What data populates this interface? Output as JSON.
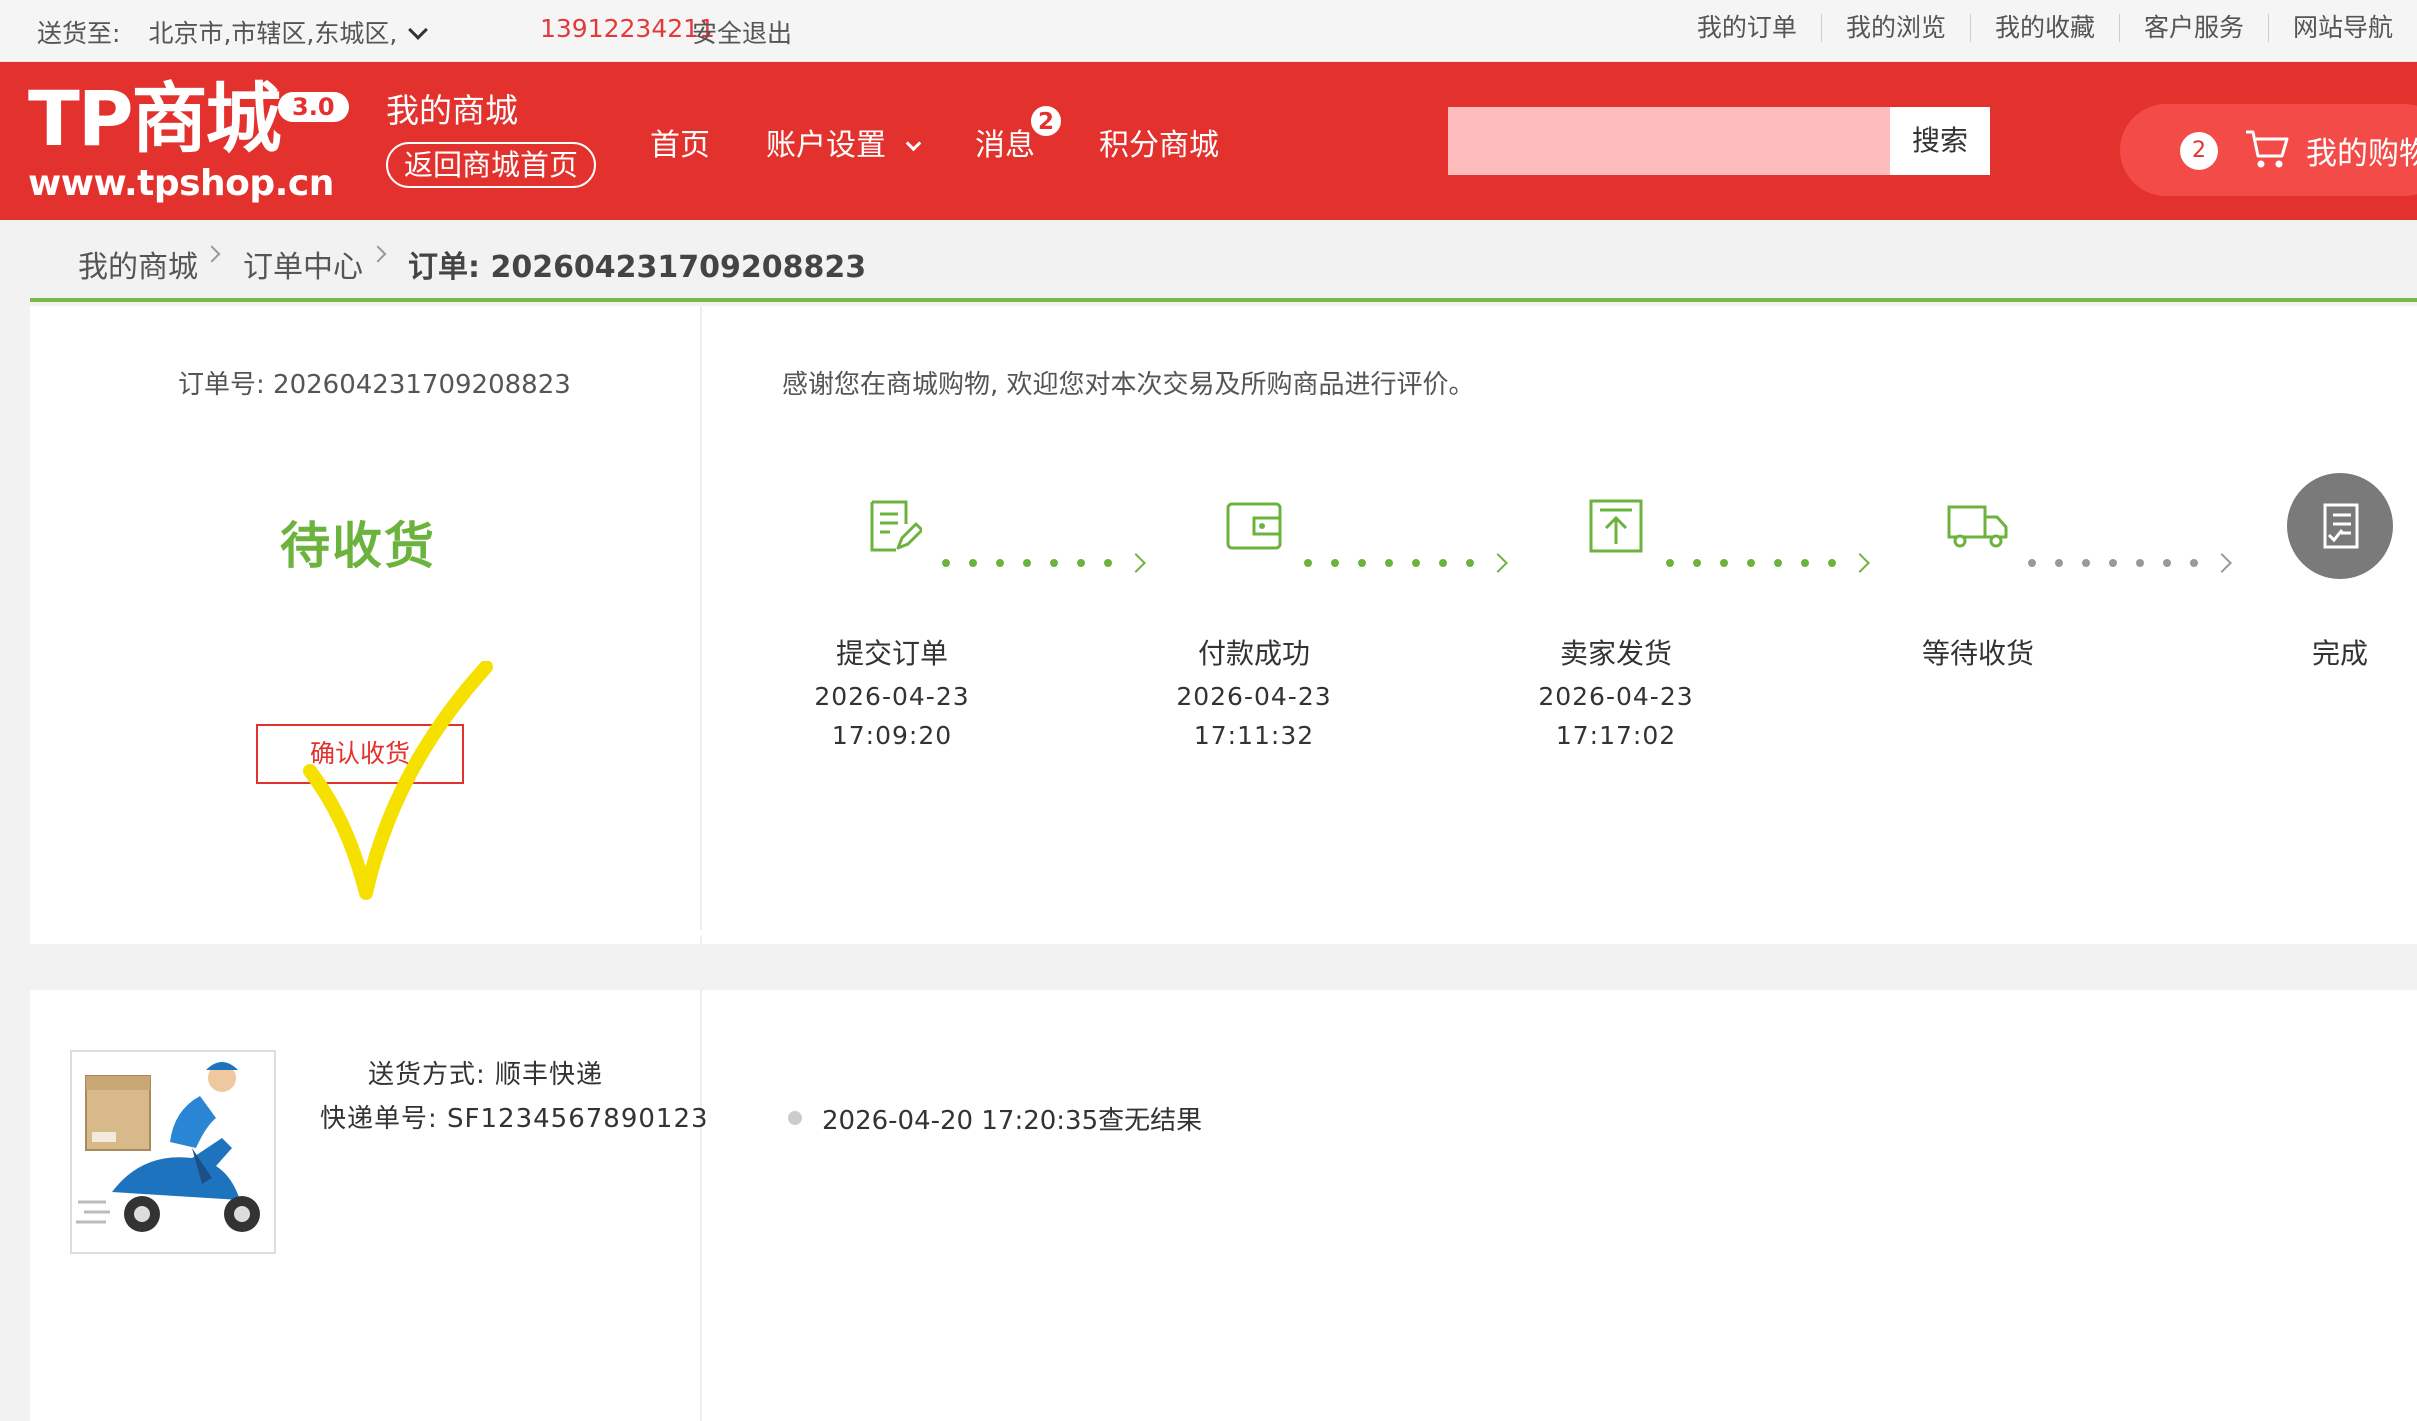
{
  "topbar": {
    "ship_label": "送货至:",
    "location": "北京市,市辖区,东城区,",
    "phone": "13912234211",
    "logout": "安全退出",
    "links": [
      "我的订单",
      "我的浏览",
      "我的收藏",
      "客户服务",
      "网站导航"
    ]
  },
  "header": {
    "logo_text": "TP商城",
    "logo_version": "3.0",
    "logo_url": "www.tpshop.cn",
    "my_store": "我的商城",
    "back_home": "返回商城首页",
    "nav": {
      "home": "首页",
      "account": "账户设置",
      "messages": "消息",
      "messages_badge": "2",
      "points": "积分商城"
    },
    "search_placeholder": "",
    "search_button": "搜索",
    "cart_count": "2",
    "cart_label": "我的购物"
  },
  "breadcrumb": {
    "items": [
      "我的商城",
      "订单中心",
      "订单: 202604231709208823"
    ]
  },
  "order": {
    "order_no": "订单号: 202604231709208823",
    "status": "待收货",
    "confirm_button": "确认收货",
    "thanks_text": "感谢您在商城购物, 欢迎您对本次交易及所购商品进行评价。",
    "steps": [
      {
        "label": "提交订单",
        "date": "2026-04-23",
        "time": "17:09:20",
        "icon": "edit-document-icon"
      },
      {
        "label": "付款成功",
        "date": "2026-04-23",
        "time": "17:11:32",
        "icon": "wallet-icon"
      },
      {
        "label": "卖家发货",
        "date": "2026-04-23",
        "time": "17:17:02",
        "icon": "upload-box-icon"
      },
      {
        "label": "等待收货",
        "date": "",
        "time": "",
        "icon": "truck-icon"
      },
      {
        "label": "完成",
        "date": "",
        "time": "",
        "icon": "checklist-icon"
      }
    ]
  },
  "shipping": {
    "method": "送货方式: 顺丰快递",
    "tracking_no": "快递单号: SF1234567890123",
    "tracking_entry": "2026-04-20 17:20:35查无结果"
  },
  "colors": {
    "brand_red": "#e3322e",
    "accent_green": "#6cb33e",
    "check_yellow": "#f5e000"
  }
}
